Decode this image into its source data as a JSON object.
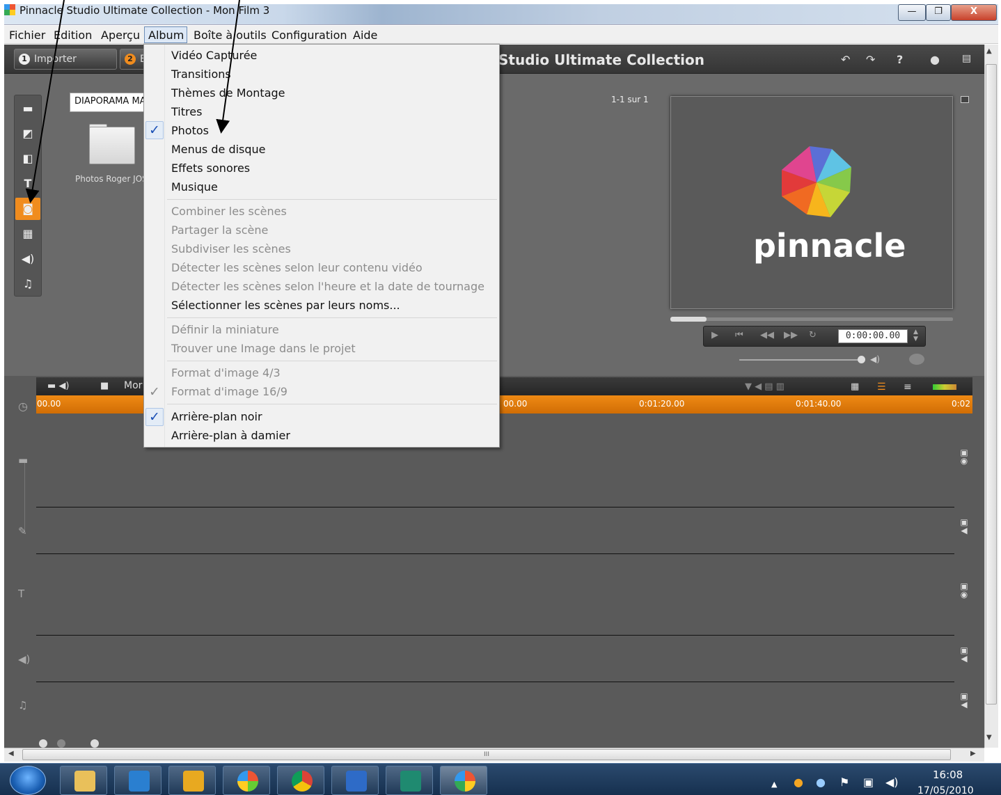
{
  "window": {
    "title": "Pinnacle Studio Ultimate Collection - Mon Film 3",
    "min_label": "—",
    "max_label": "❐",
    "close_label": "X"
  },
  "menubar": [
    "Fichier",
    "Edition",
    "Aperçu",
    "Album",
    "Boîte à outils",
    "Configuration",
    "Aide"
  ],
  "app": {
    "tabs": [
      {
        "num": "1",
        "label": "Importer"
      },
      {
        "num": "2",
        "label": "E"
      }
    ],
    "title": "Studio Ultimate Collection"
  },
  "album": {
    "select_value": "DIAPORAMA MA",
    "folder_label": "Photos Roger JOS",
    "page_count": "1-1 sur 1"
  },
  "preview": {
    "brand": "pinnacle",
    "timecode": "0:00:00.00"
  },
  "timeline": {
    "project_label": "Mor",
    "ticks": [
      "00.00",
      "00.00",
      "0:01:20.00",
      "0:01:40.00",
      "0:02"
    ]
  },
  "dropdown": {
    "group1": [
      "Vidéo Capturée",
      "Transitions",
      "Thèmes de Montage",
      "Titres",
      "Photos",
      "Menus de disque",
      "Effets sonores",
      "Musique"
    ],
    "group2": [
      "Combiner les scènes",
      "Partager la scène",
      "Subdiviser les scènes",
      "Détecter les scènes selon leur contenu vidéo",
      "Détecter les scènes selon l'heure et la date de tournage",
      "Sélectionner les scènes par leurs noms..."
    ],
    "group3": [
      "Définir la miniature",
      "Trouver une Image dans le projet"
    ],
    "group4": [
      "Format d'image 4/3",
      "Format d'image 16/9"
    ],
    "group5": [
      "Arrière-plan noir",
      "Arrière-plan à damier"
    ],
    "checkmark": "✓"
  },
  "scrollbar": {
    "grip": "III"
  },
  "taskbar": {
    "time": "16:08",
    "date": "17/05/2010"
  },
  "colors": {
    "accent_orange": "#f08c1e",
    "check_blue": "#1a4fb5",
    "app_bg": "#5a5a5a"
  }
}
